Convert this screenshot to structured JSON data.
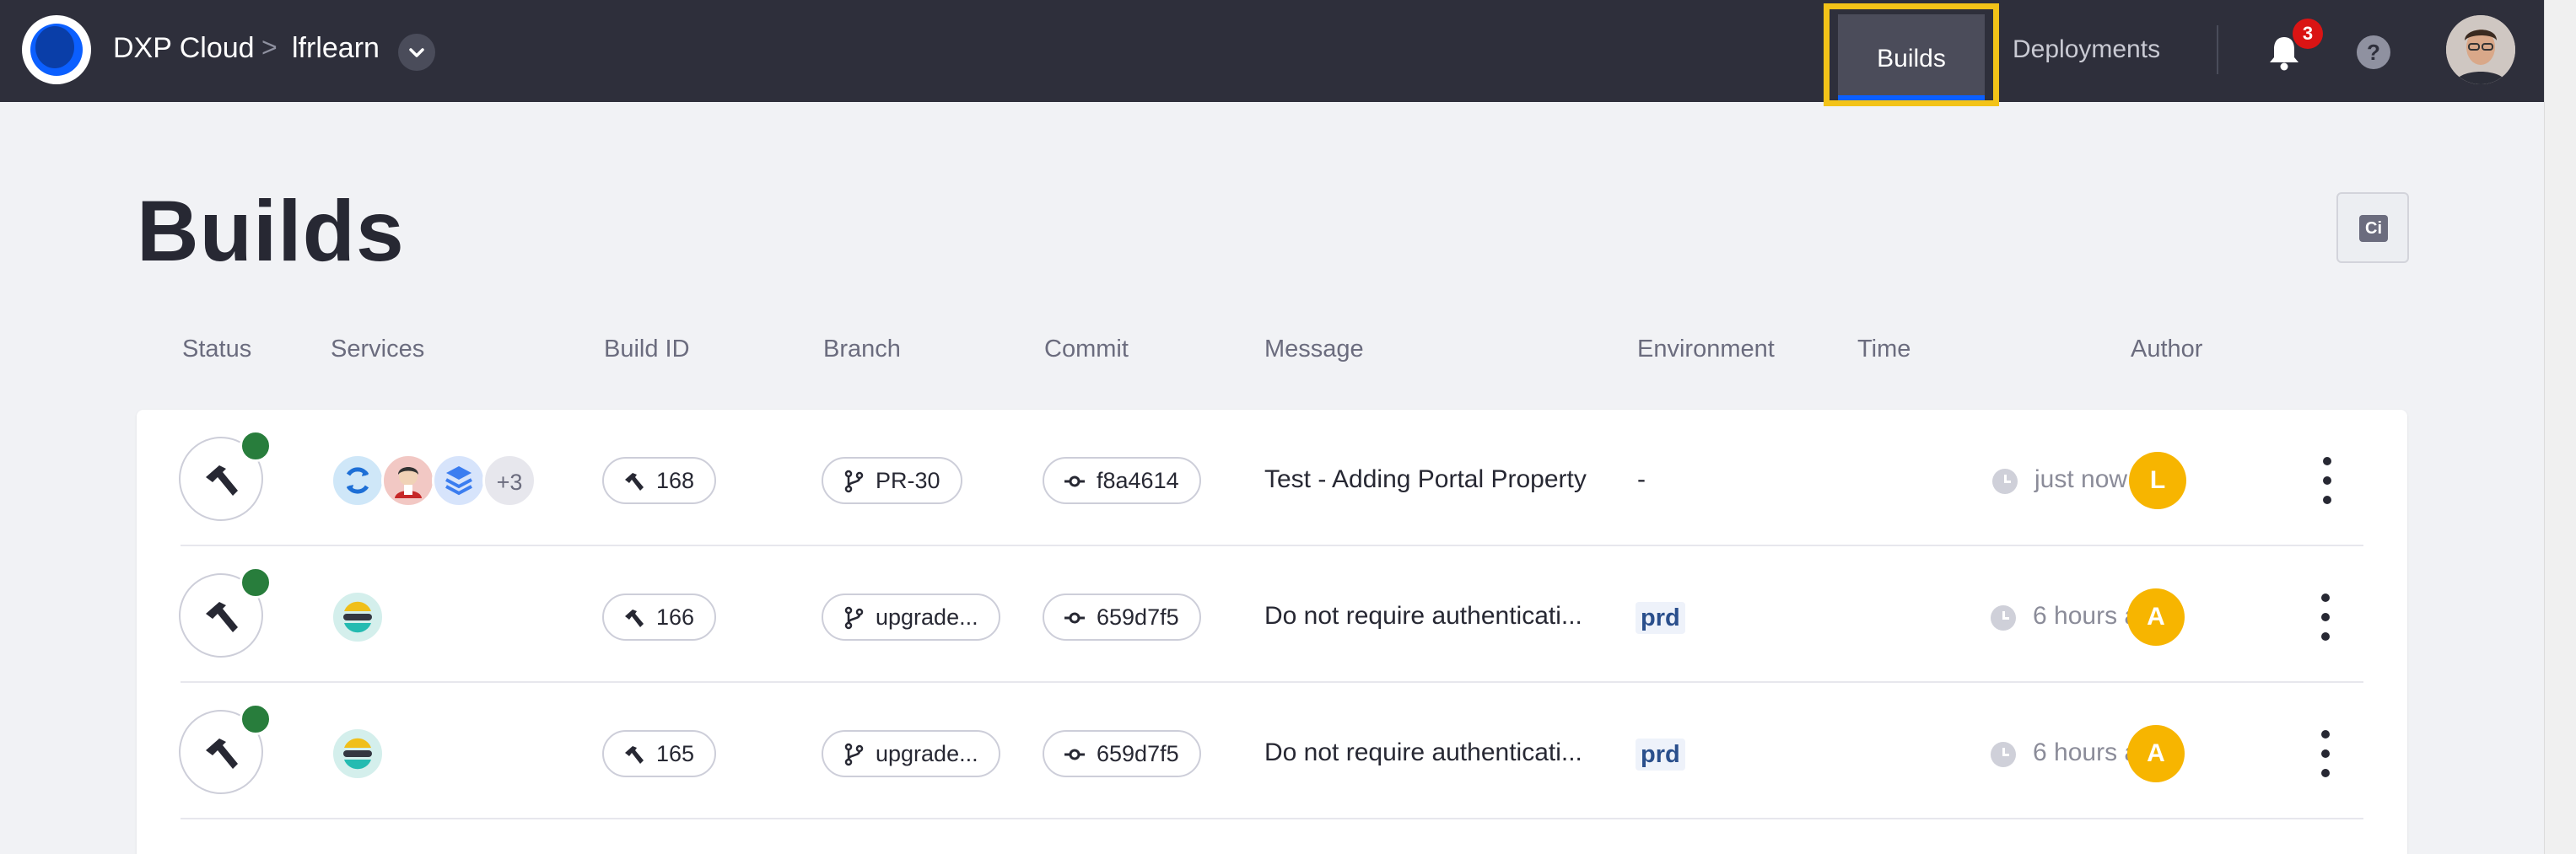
{
  "header": {
    "brand": "DXP Cloud",
    "separator": ">",
    "project": "lfrlearn",
    "project_dropdown_icon": "chevron-down-icon",
    "nav": [
      {
        "label": "Builds",
        "active": true
      },
      {
        "label": "Deployments",
        "active": false
      }
    ],
    "notifications_count": "3",
    "help_label": "?",
    "colors": {
      "bar": "#2e2f3b",
      "accent": "#0b5fff",
      "highlight": "#f3c318",
      "badge": "#da1414"
    }
  },
  "page": {
    "title": "Builds",
    "ci_label": "Ci"
  },
  "table": {
    "columns": [
      "Status",
      "Services",
      "Build ID",
      "Branch",
      "Commit",
      "Message",
      "Environment",
      "Time",
      "Author"
    ],
    "rows": [
      {
        "status": "success",
        "services": [
          "sync-service-icon",
          "jenkins-service-icon",
          "layers-service-icon"
        ],
        "services_more": "+3",
        "build_id": "168",
        "branch": "PR-30",
        "commit": "f8a4614",
        "message": "Test - Adding Portal Property",
        "environment": "-",
        "time": "just now",
        "author_initial": "L"
      },
      {
        "status": "success",
        "services": [
          "elasticsearch-service-icon"
        ],
        "services_more": "",
        "build_id": "166",
        "branch": "upgrade...",
        "commit": "659d7f5",
        "message": "Do not require authenticati...",
        "environment": "prd",
        "time": "6 hours ago",
        "author_initial": "A"
      },
      {
        "status": "success",
        "services": [
          "elasticsearch-service-icon"
        ],
        "services_more": "",
        "build_id": "165",
        "branch": "upgrade...",
        "commit": "659d7f5",
        "message": "Do not require authenticati...",
        "environment": "prd",
        "time": "6 hours ago",
        "author_initial": "A"
      }
    ]
  }
}
